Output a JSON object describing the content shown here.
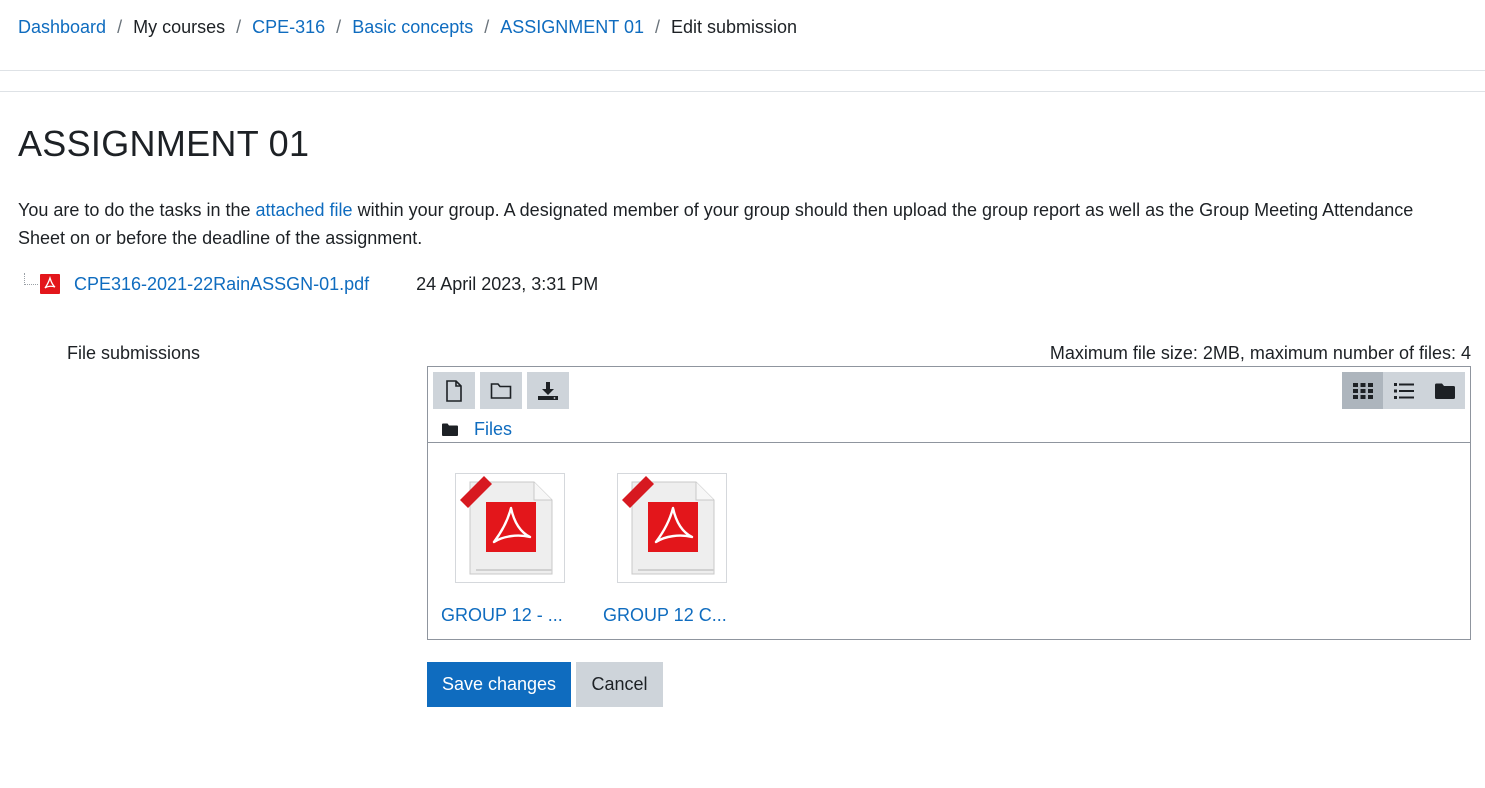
{
  "breadcrumb": {
    "items": [
      {
        "label": "Dashboard",
        "link": true
      },
      {
        "label": "My courses",
        "link": false
      },
      {
        "label": "CPE-316",
        "link": true
      },
      {
        "label": "Basic concepts",
        "link": true
      },
      {
        "label": "ASSIGNMENT 01",
        "link": true
      },
      {
        "label": "Edit submission",
        "link": false
      }
    ],
    "separator": "/"
  },
  "page": {
    "title": "ASSIGNMENT 01",
    "intro_before": "You are to do the tasks in the ",
    "intro_link": "attached file",
    "intro_after": " within your group. A designated member of your group should then upload the group report as well as the Group Meeting Attendance Sheet on or before the deadline of the assignment."
  },
  "attachment": {
    "icon": "pdf-icon",
    "filename": "CPE316-2021-22RainASSGN-01.pdf",
    "date": "24 April 2023, 3:31 PM"
  },
  "submission": {
    "label": "File submissions",
    "limits": "Maximum file size: 2MB, maximum number of files: 4",
    "toolbar": {
      "add_file_icon": "file-icon",
      "create_folder_icon": "folder-icon",
      "download_icon": "download-icon",
      "views": [
        "grid-view-icon",
        "list-view-icon",
        "tree-view-icon"
      ],
      "active_view": "grid-view-icon"
    },
    "path_label": "Files",
    "files": [
      {
        "name": "GROUP 12 - ...",
        "icon": "pdf-file-icon"
      },
      {
        "name": "GROUP 12 C...",
        "icon": "pdf-file-icon"
      }
    ]
  },
  "actions": {
    "save_label": "Save changes",
    "cancel_label": "Cancel"
  },
  "colors": {
    "link": "#0f6cbf",
    "primary": "#0f6cbf",
    "secondary": "#ced4da",
    "pdf_red": "#e3161b"
  }
}
